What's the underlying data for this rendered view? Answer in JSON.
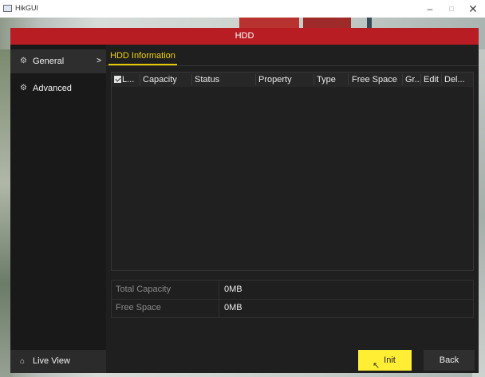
{
  "window": {
    "title": "HikGUI",
    "controls": {
      "minimize": "–",
      "maximize": "□",
      "close": "✕"
    }
  },
  "dialog": {
    "title": "HDD"
  },
  "sidebar": {
    "items": [
      {
        "label": "General",
        "icon": "gear-icon",
        "icon_glyph": "⚙",
        "chevron": ">",
        "selected": true
      },
      {
        "label": "Advanced",
        "icon": "sliders-icon",
        "icon_glyph": "⚙"
      }
    ],
    "live_view": {
      "label": "Live View",
      "icon": "home-icon",
      "icon_glyph": "⌂"
    }
  },
  "tab": {
    "label": "HDD Information"
  },
  "table": {
    "columns": [
      "L...",
      "Capacity",
      "Status",
      "Property",
      "Type",
      "Free Space",
      "Gr...",
      "Edit",
      "Del..."
    ],
    "rows": []
  },
  "summary": {
    "total_capacity": {
      "label": "Total Capacity",
      "value": "0MB"
    },
    "free_space": {
      "label": "Free Space",
      "value": "0MB"
    }
  },
  "buttons": {
    "init": "Init",
    "back": "Back"
  },
  "colors": {
    "header_red": "#b71d22",
    "accent_yellow": "#ffee33",
    "tab_yellow": "#f2d400"
  }
}
